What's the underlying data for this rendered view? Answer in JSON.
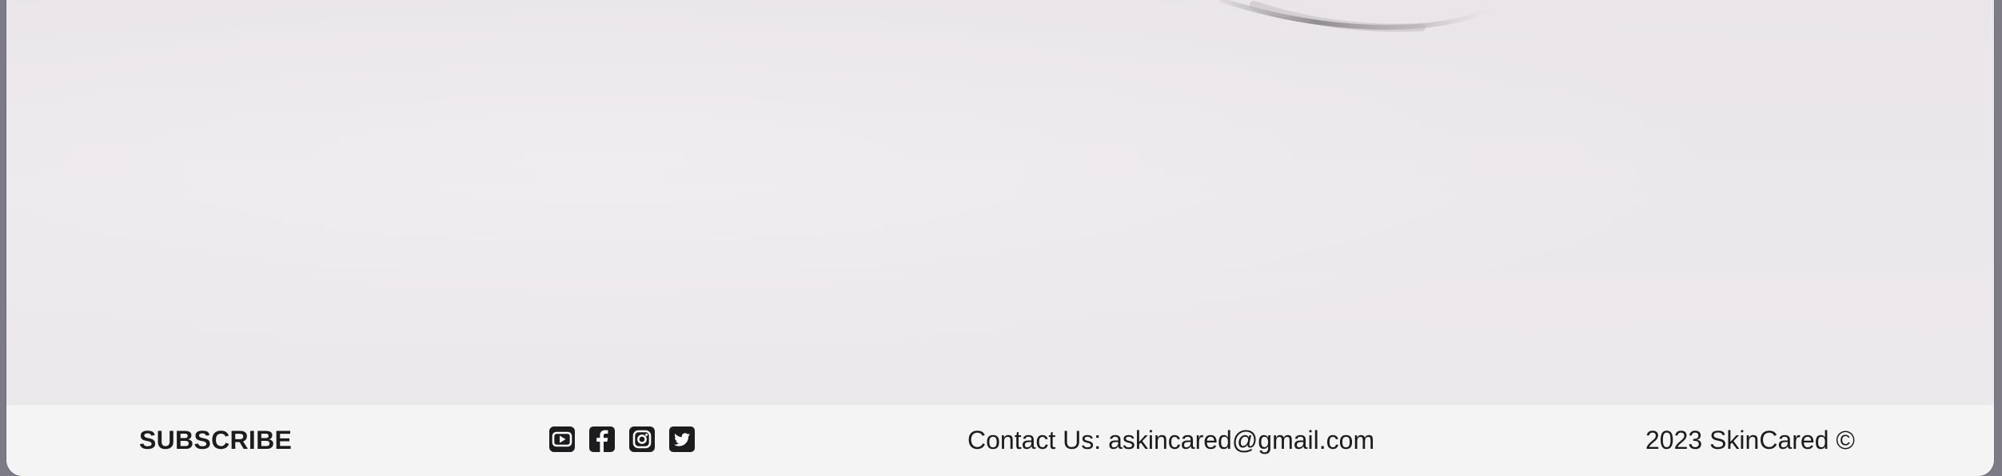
{
  "footer": {
    "subscribe_label": "SUBSCRIBE",
    "social_icons": [
      "youtube-icon",
      "facebook-icon",
      "instagram-icon",
      "twitter-icon"
    ],
    "contact_prefix": "Contact Us: ",
    "contact_email": "askincared@gmail.com",
    "copyright": "2023 SkinCared ©"
  },
  "colors": {
    "hero_background": "#ebe8eb",
    "footer_background": "#f4f4f4",
    "text": "#1c1c1f",
    "window_frame": "#7c7b86"
  }
}
